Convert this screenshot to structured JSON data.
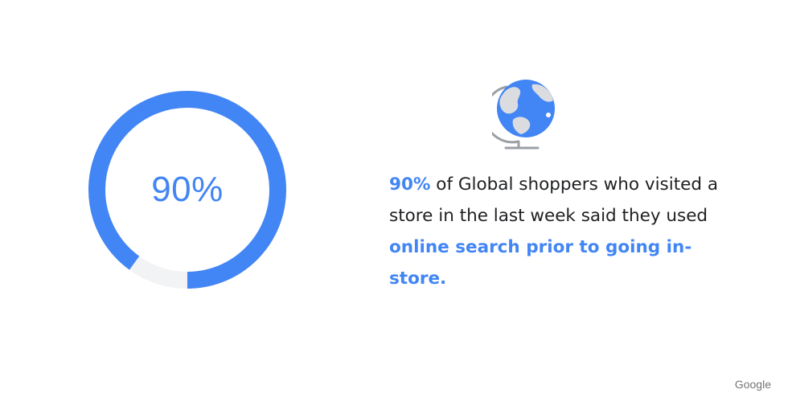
{
  "chart_data": {
    "type": "pie",
    "value_percent": 90,
    "center_label": "90%",
    "colors": {
      "filled": "#4285f4",
      "remaining": "#f1f3f4"
    }
  },
  "icon": {
    "name": "globe-icon",
    "colors": {
      "land": "#dadce0",
      "ocean": "#4285f4",
      "stand": "#9aa0a6"
    }
  },
  "statement": {
    "highlight_1": "90%",
    "text_1": " of Global shoppers who visited a store in the last week said they used ",
    "highlight_2": "online search prior to going in-store."
  },
  "brand": {
    "label": "Google"
  },
  "colors": {
    "accent": "#4285f4",
    "body_text": "#202124",
    "brand_text": "#757575"
  }
}
